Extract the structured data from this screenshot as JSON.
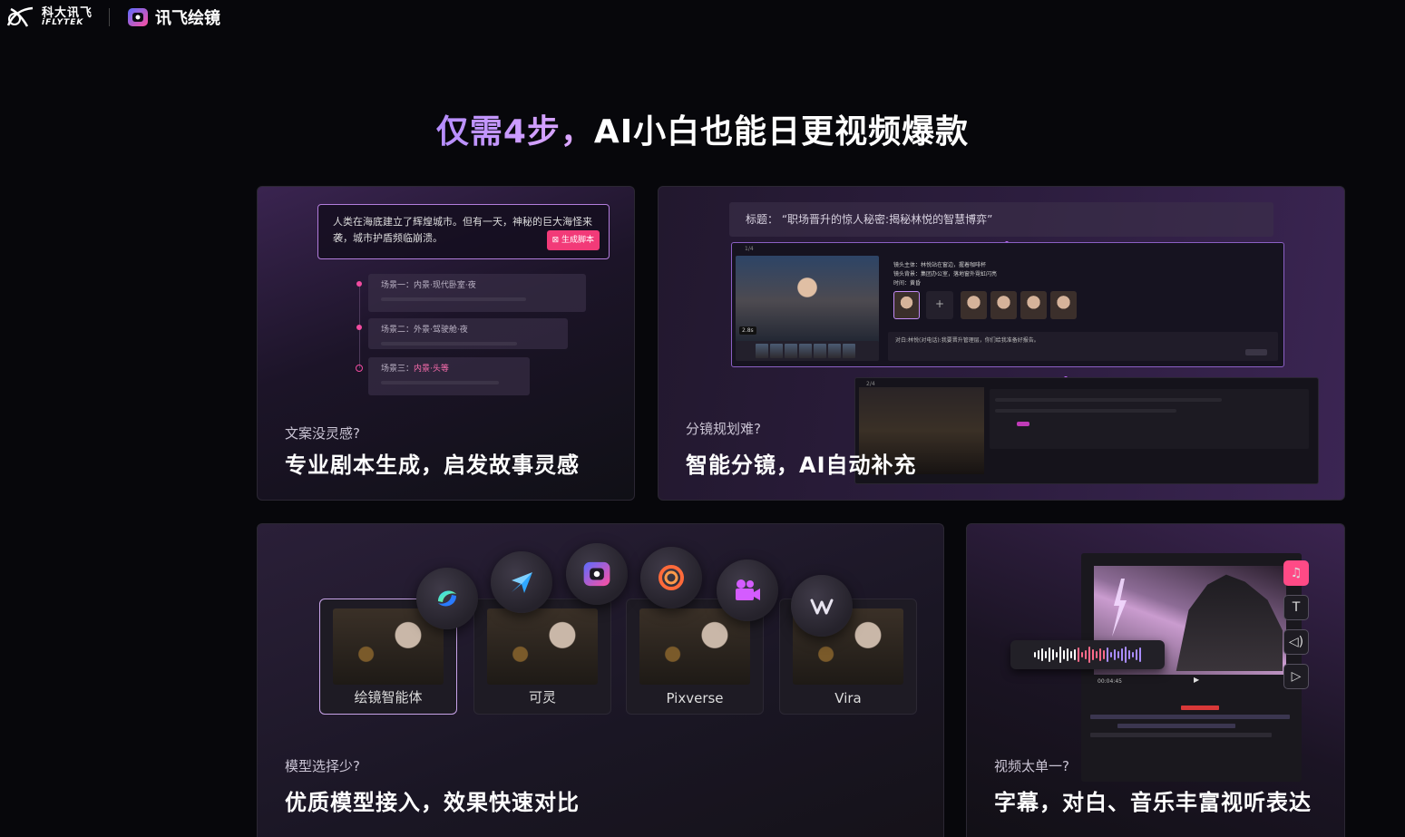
{
  "header": {
    "iflytek_cn": "科大讯飞",
    "iflytek_en": "iFLYTEK",
    "product_name": "讯飞绘镜"
  },
  "page_title": {
    "highlight": "仅需4步，",
    "rest": "AI小白也能日更视频爆款"
  },
  "colors": {
    "accent_purple": "#b58dff",
    "accent_pink": "#f23a78",
    "bg": "#07070b"
  },
  "cards": {
    "script": {
      "prompt_text": "人类在海底建立了辉煌城市。但有一天，神秘的巨大海怪来袭，城市护盾频临崩溃。",
      "generate_button": "生成脚本",
      "scenes": [
        {
          "prefix": "场景一：",
          "text": "内景·现代卧室·夜"
        },
        {
          "prefix": "场景二：",
          "text": "外景·驾驶舱·夜"
        },
        {
          "prefix": "场景三：",
          "text": "内景·头等"
        }
      ],
      "subtitle": "文案没灵感?",
      "heading": "专业剧本生成，启发故事灵感"
    },
    "storyboard": {
      "title_label": "标题：",
      "title_value": "“职场晋升的惊人秘密:揭秘林悦的智慧博弈”",
      "shot_count": "1/4",
      "shot_count_2": "2/4",
      "badge": "2.8s",
      "info_lines": [
        "镜头主体：林悦站在窗边，握着咖啡杯",
        "镜头背景：集团办公室，落地窗外霓虹闪亮",
        "时间：黄昏"
      ],
      "add_label": "+",
      "dialog_text": "对白:林悦(对电话):我要晋升管理层，你们给我准备好报告。",
      "subtitle": "分镜规划难?",
      "heading": "智能分镜，AI自动补充"
    },
    "models": {
      "items": [
        {
          "label": "绘镜智能体",
          "active": true
        },
        {
          "label": "可灵",
          "active": false
        },
        {
          "label": "Pixverse",
          "active": false
        },
        {
          "label": "Vira",
          "active": false
        }
      ],
      "icons": [
        "swirl-app-icon",
        "paper-plane-app-icon",
        "huijing-app-icon",
        "spiral-app-icon",
        "video-camera-app-icon",
        "vidu-app-icon"
      ],
      "subtitle": "模型选择少?",
      "heading": "优质模型接入，效果快速对比"
    },
    "editor": {
      "timecode": "00:04:45",
      "tool_icons": [
        "music-note-icon",
        "text-icon",
        "volume-icon",
        "play-box-icon"
      ],
      "subtitle": "视频太单一?",
      "heading": "字幕，对白、音乐丰富视听表达"
    }
  }
}
